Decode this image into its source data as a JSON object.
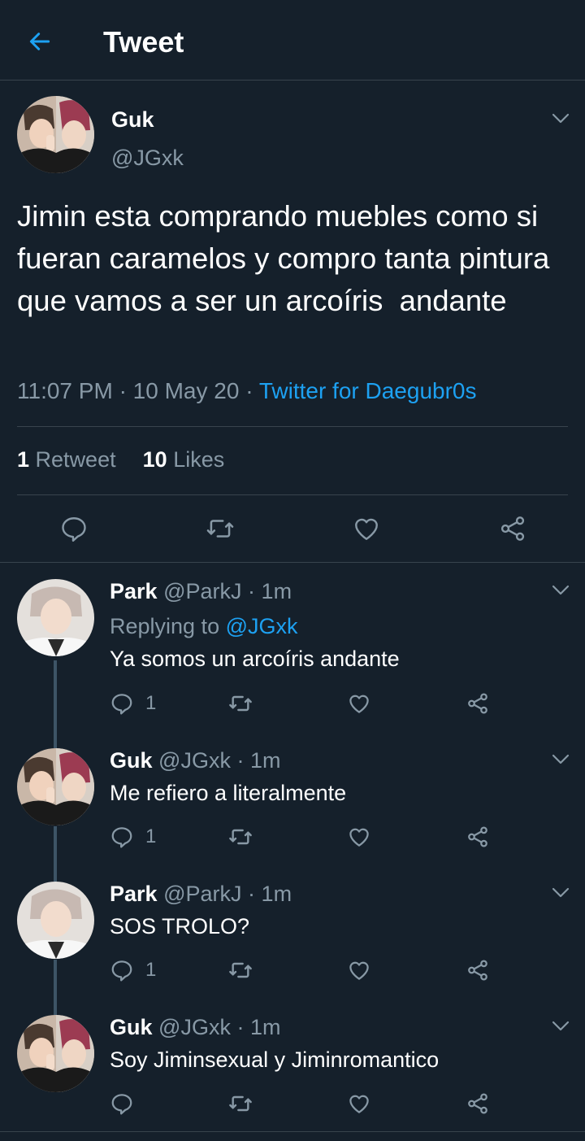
{
  "header": {
    "title": "Tweet",
    "back_icon": "arrow-left-icon"
  },
  "colors": {
    "background": "#15202b",
    "accent": "#1da1f2",
    "muted": "#8899a6",
    "border": "#38444d"
  },
  "tweet": {
    "name": "Guk",
    "handle": "@JGxk",
    "text": "Jimin esta comprando muebles como si fueran caramelos y compro tanta pintura que vamos a ser un arcoíris  andante",
    "time": "11:07 PM",
    "date": "10 May 20",
    "sep": "·",
    "source": "Twitter for Daegubr0s",
    "retweets_count": "1",
    "retweets_label": "Retweet",
    "likes_count": "10",
    "likes_label": "Likes",
    "actions": [
      "reply-icon",
      "retweet-icon",
      "like-icon",
      "share-icon"
    ]
  },
  "replies": [
    {
      "name": "Park",
      "handle": "@ParkJ",
      "sep": "·",
      "time": "1m",
      "replying_label": "Replying to",
      "replying_to": "@JGxk",
      "text": "Ya somos un arcoíris andante",
      "reply_count": "1"
    },
    {
      "name": "Guk",
      "handle": "@JGxk",
      "sep": "·",
      "time": "1m",
      "text": "Me refiero a literalmente",
      "reply_count": "1"
    },
    {
      "name": "Park",
      "handle": "@ParkJ",
      "sep": "·",
      "time": "1m",
      "text": "SOS TROLO?",
      "reply_count": "1"
    },
    {
      "name": "Guk",
      "handle": "@JGxk",
      "sep": "·",
      "time": "1m",
      "text": "Soy Jiminsexual y Jiminromantico",
      "reply_count": ""
    }
  ]
}
